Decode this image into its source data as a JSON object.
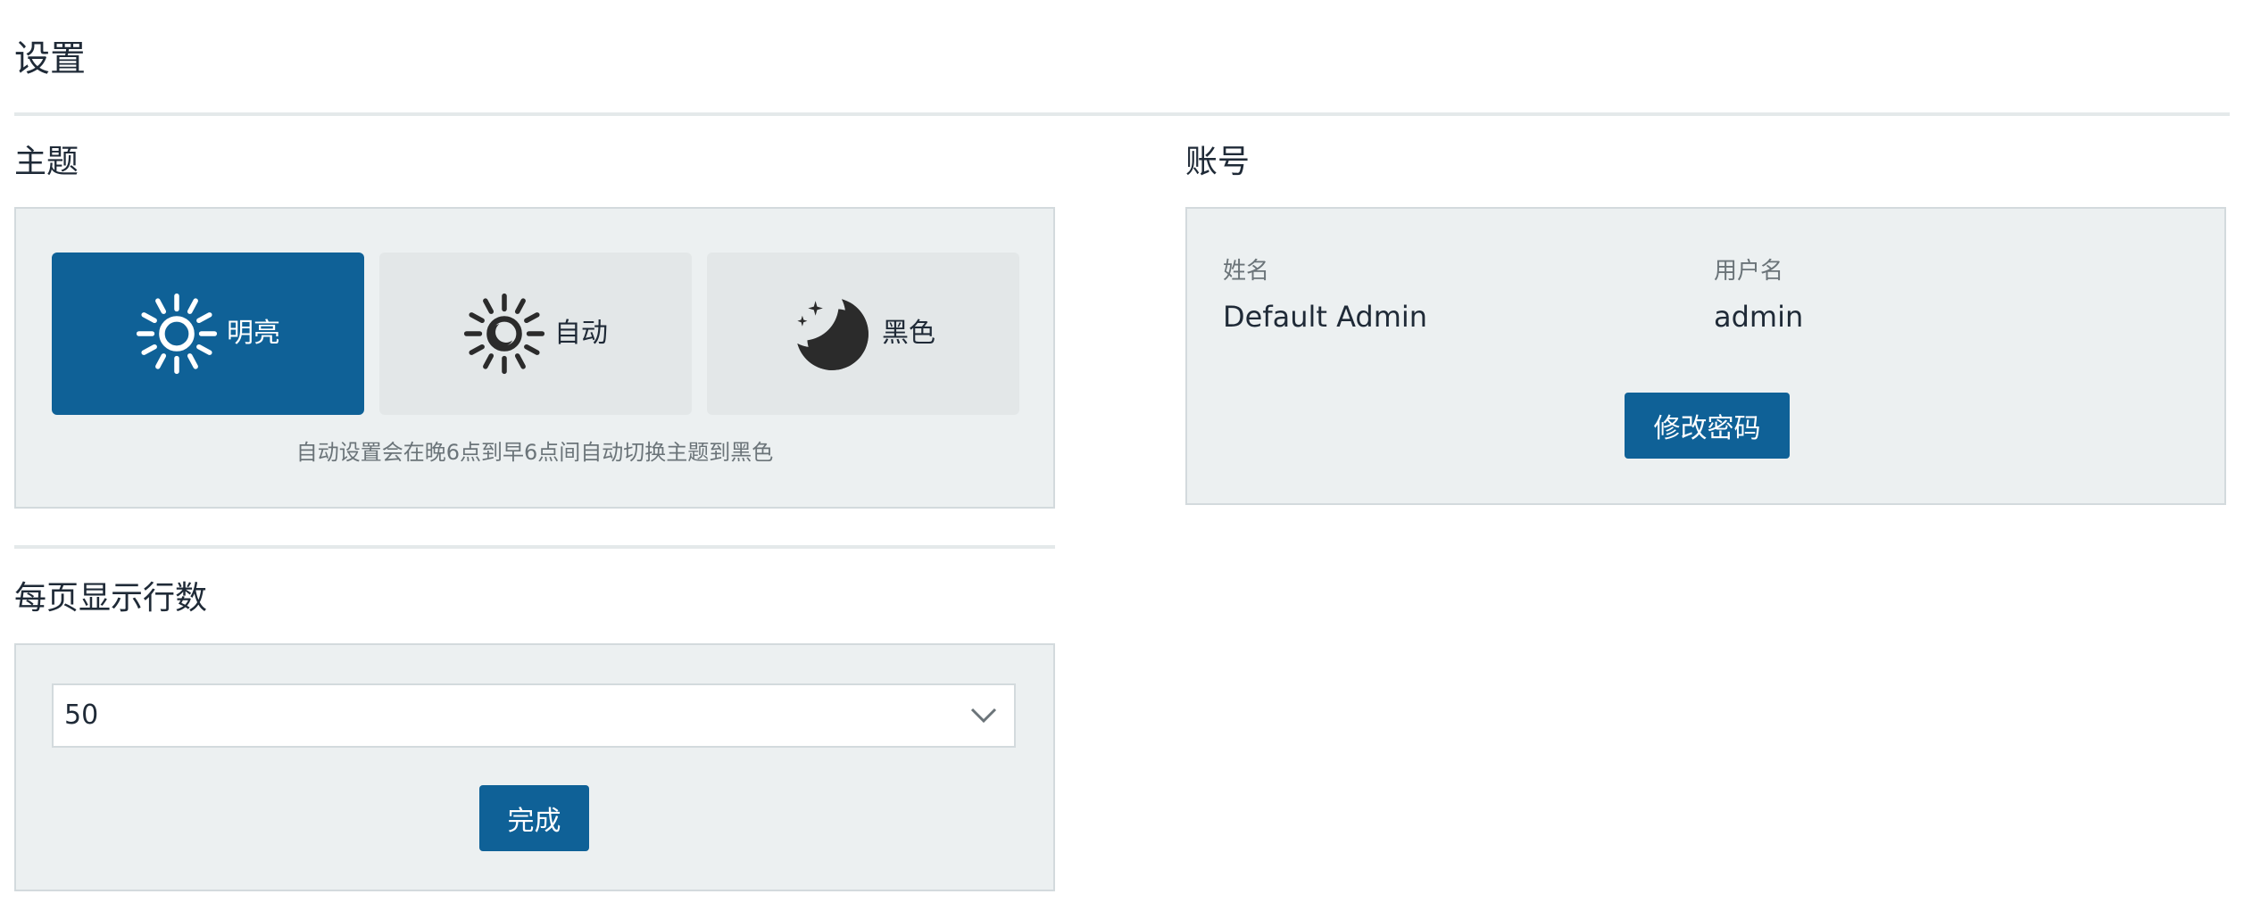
{
  "page": {
    "title": "设置"
  },
  "theme": {
    "title": "主题",
    "options": [
      {
        "label": "明亮",
        "icon": "sun-icon",
        "selected": true
      },
      {
        "label": "自动",
        "icon": "auto-sun-moon-icon",
        "selected": false
      },
      {
        "label": "黑色",
        "icon": "moon-stars-icon",
        "selected": false
      }
    ],
    "hint": "自动设置会在晚6点到早6点间自动切换主题到黑色"
  },
  "rows_per_page": {
    "title": "每页显示行数",
    "selected_value": "50",
    "done_label": "完成"
  },
  "account": {
    "title": "账号",
    "name_label": "姓名",
    "name_value": "Default Admin",
    "username_label": "用户名",
    "username_value": "admin",
    "change_password_label": "修改密码"
  },
  "colors": {
    "accent": "#0f6197",
    "panel_bg": "#ecf0f1",
    "inactive_option_bg": "#e3e7e8",
    "text": "#1f2a37",
    "muted_text": "#6b7479"
  }
}
